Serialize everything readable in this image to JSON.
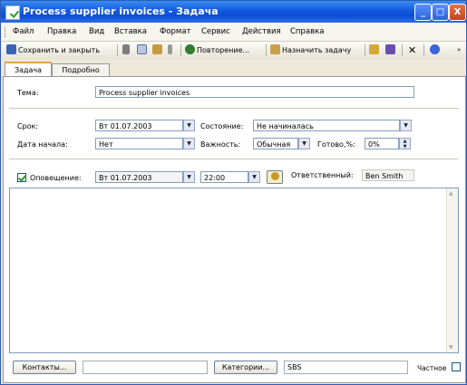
{
  "window": {
    "title": "Process supplier invoices - Задача",
    "controls": [
      "_",
      "□",
      "X"
    ]
  },
  "menu": [
    "Файл",
    "Правка",
    "Вид",
    "Вставка",
    "Формат",
    "Сервис",
    "Действия",
    "Справка"
  ],
  "toolbar": {
    "save_close": "Сохранить и закрыть",
    "recurrence": "Повторение...",
    "assign_task": "Назначить задачу"
  },
  "tabs": [
    "Задача",
    "Подробно"
  ],
  "form": {
    "subject_label": "Тема:",
    "subject_value": "Process supplier invoices",
    "due_label": "Срок:",
    "due_value": "Вт 01.07.2003",
    "status_label": "Состояние:",
    "status_value": "Не начиналась",
    "start_label": "Дата начала:",
    "start_value": "Нет",
    "priority_label": "Важность:",
    "priority_value": "Обычная",
    "complete_label": "Готово,%:",
    "complete_value": "0%",
    "reminder_label": "Оповещение:",
    "reminder_date": "Вт 01.07.2003",
    "reminder_time": "22:00",
    "owner_label": "Ответственный:",
    "owner_value": "Ben Smith"
  },
  "footer": {
    "contacts_button": "Контакты...",
    "contacts_value": "",
    "categories_button": "Категории...",
    "categories_value": "SBS",
    "private_label": "Частное"
  }
}
